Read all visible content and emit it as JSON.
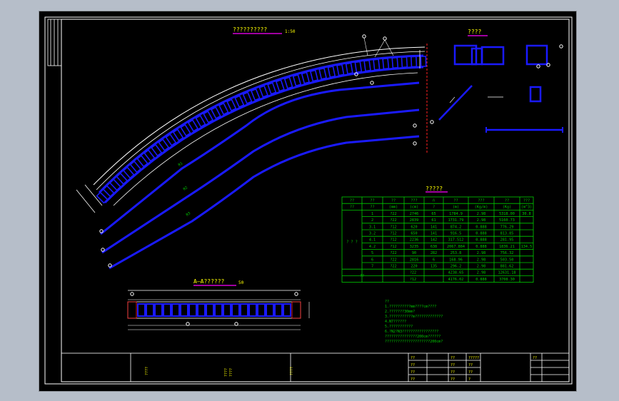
{
  "colors": {
    "app_bg": "#b6bec9",
    "canvas_bg": "#000000",
    "frame": "#ffffff",
    "rebar": "#1a1aff",
    "table_line": "#00cc00",
    "dim": "#ffffff",
    "title_underline": "#ff00ff",
    "yellow_text": "#ffff00",
    "axis_red": "#ff2020"
  },
  "drawing": {
    "plan_title": "??????????",
    "plan_scale": "1:50",
    "section_title": "????",
    "table_title": "?????",
    "aa_title": "A—A??????",
    "aa_scale": "50",
    "curve_labels": [
      "R1",
      "R2",
      "R3"
    ]
  },
  "rebar_table": {
    "headers1": [
      "??",
      "??",
      "??",
      "???",
      "ñ",
      "??",
      "???",
      "??",
      "???"
    ],
    "headers2": [
      "??",
      "??",
      "(mm)",
      "(cm)",
      "?",
      "(m)",
      "(Kg/m)",
      "(Kg)",
      "(m^3)"
    ],
    "group_label": "? ? ?",
    "rows": [
      [
        "1",
        "?22",
        "2746",
        "65",
        "1784.9",
        "2.98",
        "5318.00"
      ],
      [
        "2",
        "?22",
        "2839",
        "61",
        "1731.79",
        "2.98",
        "5160.73"
      ],
      [
        "3.1",
        "?12",
        "620",
        "141",
        "874.2",
        "0.888",
        "776.29"
      ],
      [
        "3.2",
        "?12",
        "650",
        "141",
        "916.5",
        "0.888",
        "813.85"
      ],
      [
        "4.1",
        "?12",
        "2236",
        "142",
        "317.512",
        "0.888",
        "281.95"
      ],
      [
        "4.2",
        "?12",
        "3235",
        "638",
        "2067.884",
        "0.888",
        "1836.21"
      ],
      [
        "5",
        "?22",
        "90",
        "282",
        "253.8",
        "2.98",
        "756.32"
      ],
      [
        "6",
        "?22",
        "2816",
        "6",
        "168.96",
        "2.98",
        "503.50"
      ],
      [
        "7",
        "?22",
        "220",
        "135",
        "296.2",
        "2.98",
        "881.62"
      ]
    ],
    "concrete_top": "30.8",
    "concrete_total": "134.5",
    "sum_label": "??",
    "sum_rows": [
      [
        "?22",
        "4238.65",
        "2.98",
        "12631.18"
      ],
      [
        "?12",
        "4176.02",
        "0.888",
        "3708.30"
      ]
    ]
  },
  "notes": [
    "??",
    "1.??????????mm????cm????",
    "2.???????30mm?",
    "3.???????????m?????????????",
    "4.N7??????",
    "5.???????????",
    "6.?N2?N3?????????????????",
    "  ???????????????200cm??????",
    "  ?????????????????????200cm?"
  ],
  "title_block": {
    "cells": [
      "????",
      "????\n????",
      "????",
      "??",
      "??",
      "??",
      "??",
      "??",
      "??",
      "??",
      "??",
      "?????",
      "??",
      "??",
      "?",
      "??"
    ]
  }
}
